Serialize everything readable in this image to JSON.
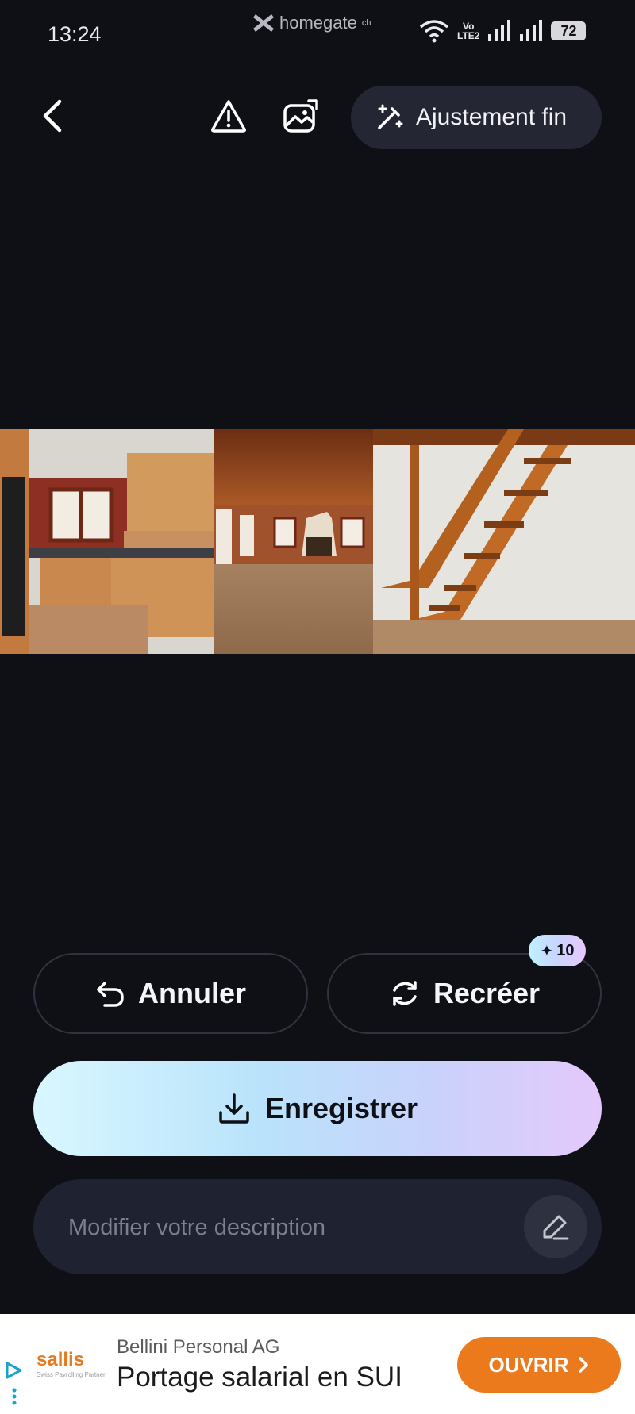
{
  "status_bar": {
    "time": "13:24",
    "notification_app": "homegate",
    "notification_app_suffix": "ch",
    "network_label_top": "Vo",
    "network_label_bottom": "LTE2",
    "battery": "72"
  },
  "toolbar": {
    "back_icon": "chevron-left-icon",
    "report_icon": "warning-triangle-icon",
    "gallery_icon": "image-stack-icon",
    "fine_tune_label": "Ajustement fin",
    "fine_tune_icon": "magic-wand-icon"
  },
  "actions": {
    "undo_label": "Annuler",
    "regenerate_label": "Recréer",
    "credits": "10",
    "save_label": "Enregistrer",
    "description_placeholder": "Modifier votre description"
  },
  "ad": {
    "brand": "sallis",
    "brand_tagline": "Swiss Payrolling Partner",
    "company": "Bellini Personal AG",
    "title": "Portage salarial en SUI",
    "cta": "OUVRIR"
  },
  "colors": {
    "background": "#0f1016",
    "button_dark": "#242733",
    "cta_orange": "#ea7a1c"
  }
}
